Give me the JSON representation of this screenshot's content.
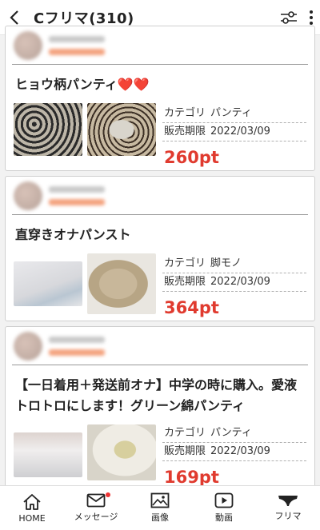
{
  "header": {
    "title": "Cフリマ(310)"
  },
  "items": [
    {
      "title": "ヒョウ柄パンティ❤️❤️",
      "category_label": "カテゴリ",
      "category": "パンティ",
      "period_label": "販売期限",
      "period": "2022/03/09",
      "price": "260pt"
    },
    {
      "title": "直穿きオナパンスト",
      "category_label": "カテゴリ",
      "category": "脚モノ",
      "period_label": "販売期限",
      "period": "2022/03/09",
      "price": "364pt"
    },
    {
      "title": "【一日着用＋発送前オナ】中学の時に購入。愛液トロトロにします！グリーン綿パンティ",
      "category_label": "カテゴリ",
      "category": "パンティ",
      "period_label": "販売期限",
      "period": "2022/03/09",
      "price": "169pt"
    }
  ],
  "tabbar": {
    "home": "HOME",
    "message": "メッセージ",
    "images": "画像",
    "video": "動画",
    "flea": "フリマ"
  },
  "colors": {
    "price": "#e03b2f",
    "badge": "#e33333"
  }
}
